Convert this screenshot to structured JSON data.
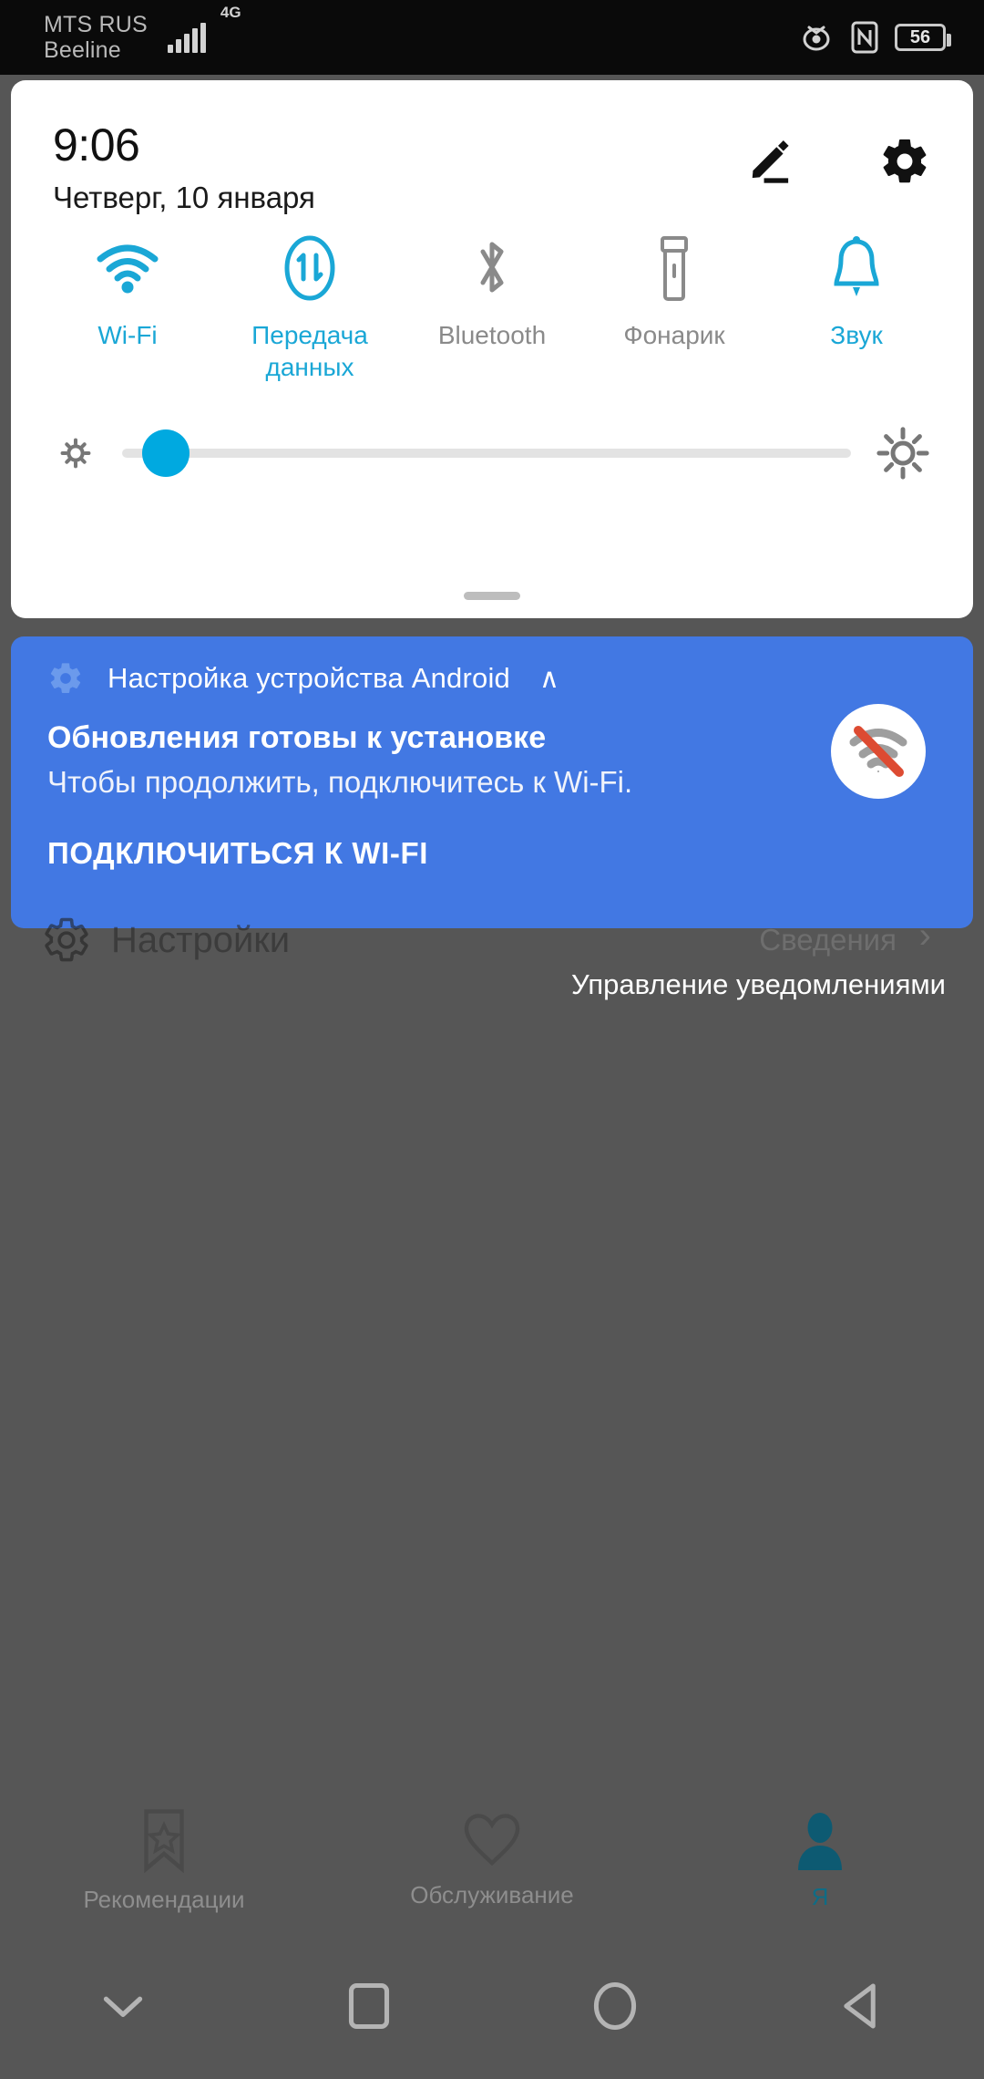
{
  "statusbar": {
    "carrier1": "MTS RUS",
    "carrier2": "Beeline",
    "network_type": "4G",
    "battery_percent": "56",
    "icons": [
      "signal-bars-sim1",
      "signal-bars-sim2",
      "eye-comfort-icon",
      "nfc-icon",
      "battery-icon"
    ]
  },
  "quick_settings": {
    "time": "9:06",
    "date": "Четверг, 10 января",
    "edit_label": "edit-icon",
    "settings_label": "gear-icon",
    "toggles": [
      {
        "label": "Wi-Fi",
        "icon": "wifi-icon",
        "state": "on"
      },
      {
        "label": "Передача данных",
        "icon": "mobile-data-icon",
        "state": "on"
      },
      {
        "label": "Bluetooth",
        "icon": "bluetooth-icon",
        "state": "off"
      },
      {
        "label": "Фонарик",
        "icon": "flashlight-icon",
        "state": "off"
      },
      {
        "label": "Звук",
        "icon": "bell-icon",
        "state": "on"
      }
    ],
    "brightness": {
      "value_percent": 6,
      "low_icon": "brightness-low-icon",
      "high_icon": "brightness-high-icon"
    }
  },
  "notification": {
    "app_name": "Настройка устройства Android",
    "collapse_chevron": "∧",
    "title": "Обновления готовы к установке",
    "body": "Чтобы продолжить, подключитесь к Wi-Fi.",
    "action": "ПОДКЛЮЧИТЬСЯ К WI-FI",
    "badge_icon": "wifi-off-icon",
    "background_color": "#4278e3"
  },
  "behind_shade": {
    "settings_label": "Настройки",
    "details_label": "Сведения",
    "manage_notifications": "Управление уведомлениями"
  },
  "tabbar": {
    "items": [
      {
        "label": "Рекомендации",
        "icon": "bookmark-star-icon",
        "active": false
      },
      {
        "label": "Обслуживание",
        "icon": "heart-icon",
        "active": false
      },
      {
        "label": "Я",
        "icon": "person-icon",
        "active": true
      }
    ]
  },
  "navbar": {
    "items": [
      {
        "name": "collapse-icon"
      },
      {
        "name": "recents-icon"
      },
      {
        "name": "home-icon"
      },
      {
        "name": "back-icon"
      }
    ]
  },
  "colors": {
    "accent_blue": "#1aa7d6",
    "notification_blue": "#4278e3",
    "inactive_gray": "#8a8a8a",
    "tab_active": "#0f6c85"
  }
}
